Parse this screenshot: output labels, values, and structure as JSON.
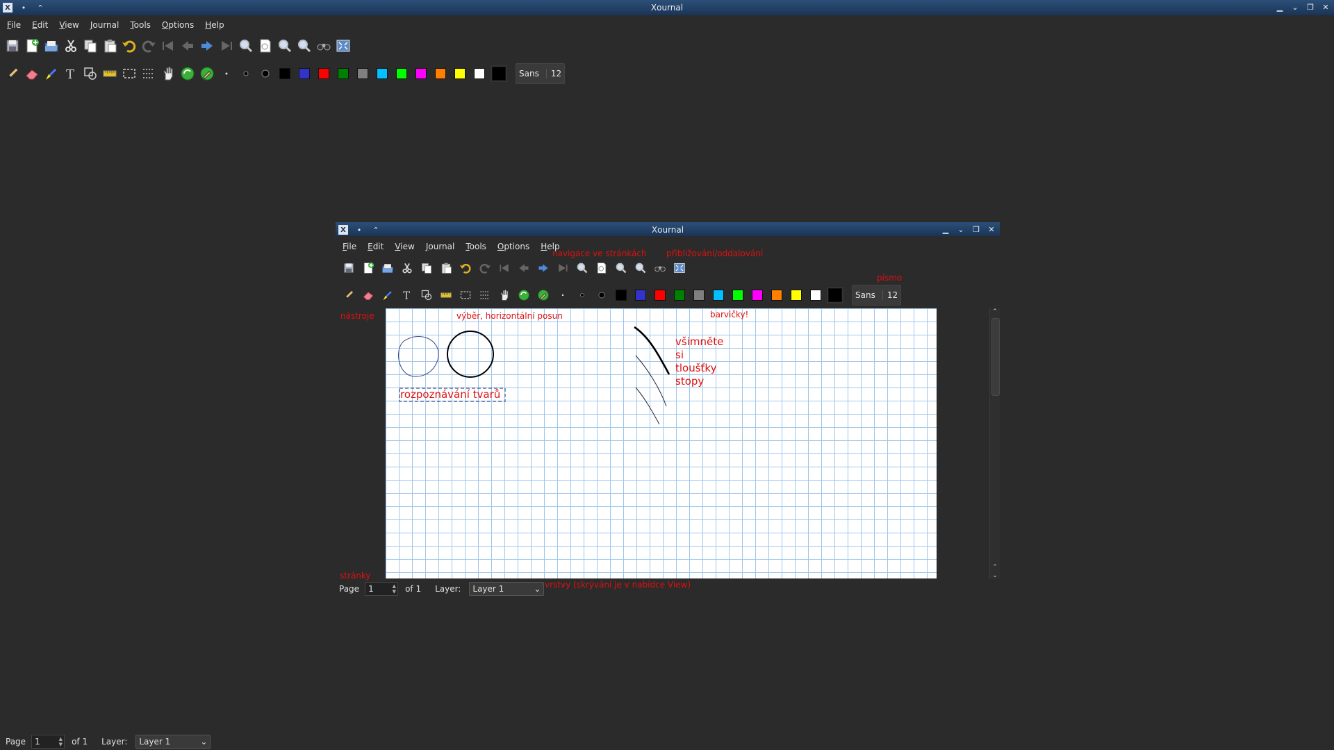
{
  "window": {
    "title": "Xournal"
  },
  "menu": [
    {
      "label": "File",
      "accel": "F"
    },
    {
      "label": "Edit",
      "accel": "E"
    },
    {
      "label": "View",
      "accel": "V"
    },
    {
      "label": "Journal",
      "accel": "J"
    },
    {
      "label": "Tools",
      "accel": "T"
    },
    {
      "label": "Options",
      "accel": "O"
    },
    {
      "label": "Help",
      "accel": "H"
    }
  ],
  "toolbar_main": [
    "save-icon",
    "new-page-icon",
    "open-icon",
    "cut-icon",
    "copy-icon",
    "paste-icon",
    "undo-icon",
    "redo-icon",
    "first-page-icon",
    "previous-page-icon",
    "next-page-icon",
    "last-page-icon",
    "zoom-fit-icon",
    "page-width-icon",
    "zoom-in-icon",
    "zoom-out-icon",
    "binoculars-icon",
    "fullscreen-icon"
  ],
  "toolbar_tools": [
    "pen-icon",
    "eraser-icon",
    "highlighter-icon",
    "text-icon",
    "shape-recognizer-icon",
    "ruler-icon",
    "select-rectangle-icon",
    "select-region-icon",
    "hand-icon",
    "default-tool-icon",
    "default-pen-icon",
    "thin-icon",
    "medium-icon",
    "thick-icon"
  ],
  "colors": [
    {
      "name": "black",
      "hex": "#000000"
    },
    {
      "name": "blue",
      "hex": "#3333cc"
    },
    {
      "name": "red",
      "hex": "#ff0000"
    },
    {
      "name": "green",
      "hex": "#008000"
    },
    {
      "name": "gray",
      "hex": "#808080"
    },
    {
      "name": "light-blue",
      "hex": "#00c0ff"
    },
    {
      "name": "light-green",
      "hex": "#00ff00"
    },
    {
      "name": "magenta",
      "hex": "#ff00ff"
    },
    {
      "name": "orange",
      "hex": "#ff8000"
    },
    {
      "name": "yellow",
      "hex": "#ffff00"
    },
    {
      "name": "white",
      "hex": "#ffffff"
    }
  ],
  "current_color": "#000000",
  "font": {
    "name": "Sans",
    "size": "12"
  },
  "status": {
    "page_label": "Page",
    "page_value": "1",
    "of_label": "of 1",
    "layer_label": "Layer:",
    "layer_value": "Layer 1"
  },
  "annotations": {
    "navigation": "navigace ve stránkách",
    "zoom": "přibližování/oddalování",
    "font": "písmo",
    "tools": "nástroje",
    "selection": "výběr, horizontální posun",
    "colors": "barvičky!",
    "note_lines": [
      "všimněte",
      "si",
      "tloušťky",
      "stopy"
    ],
    "shape_recognition": "rozpoznávání tvarů",
    "pages": "stránky",
    "layers": "vrstvy (skrývání je v nabídce View)"
  },
  "accent": "#e01010"
}
